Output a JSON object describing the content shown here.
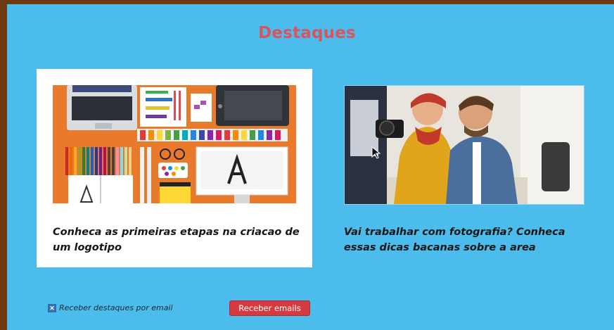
{
  "section": {
    "title": "Destaques"
  },
  "cards": [
    {
      "title": "Conheca as primeiras etapas na criacao de um logotipo"
    },
    {
      "title": "Vai trabalhar com fotografia? Conheca essas dicas bacanas sobre a area"
    }
  ],
  "newsletter": {
    "checkbox_label": "Receber destaques por email",
    "checked": true,
    "button_label": "Receber emails"
  },
  "colors": {
    "background": "#4bbcec",
    "title": "#d8545f",
    "button": "#d63a3f",
    "card": "#ffffff"
  }
}
